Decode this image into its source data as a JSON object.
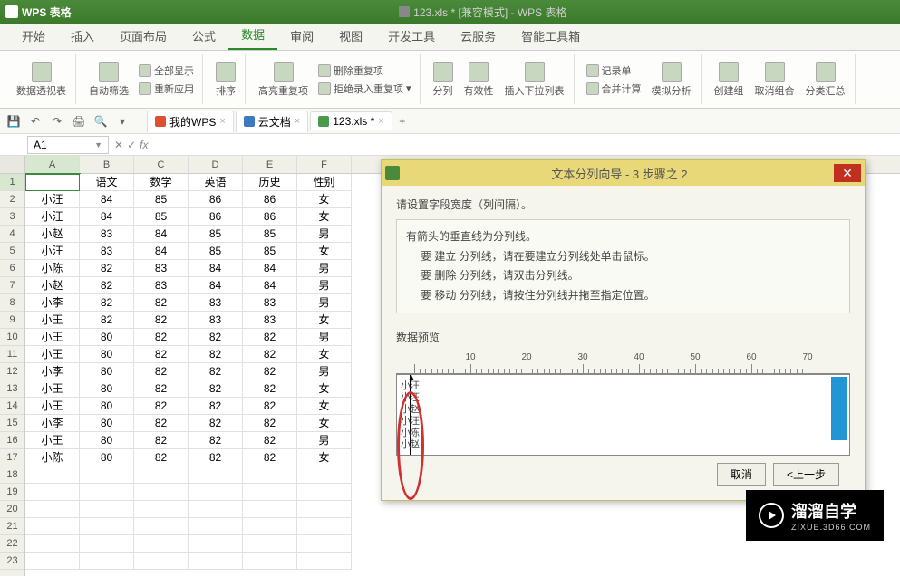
{
  "app": {
    "name": "WPS 表格",
    "doc": "123.xls * [兼容模式] - WPS 表格"
  },
  "menu": {
    "tabs": [
      "开始",
      "插入",
      "页面布局",
      "公式",
      "数据",
      "审阅",
      "视图",
      "开发工具",
      "云服务",
      "智能工具箱"
    ],
    "active": 4
  },
  "ribbon": {
    "pivot": "数据透视表",
    "autofilter": "自动筛选",
    "showall": "全部显示",
    "reapply": "重新应用",
    "sort": "排序",
    "highlight": "高亮重复项",
    "removedup": "删除重复项",
    "rejectdup": "拒绝录入重复项",
    "texttocols": "分列",
    "validation": "有效性",
    "insertdrop": "插入下拉列表",
    "recordsheet": "记录单",
    "consolidate": "合并计算",
    "whatif": "模拟分析",
    "group": "创建组",
    "ungroup": "取消组合",
    "subtotal": "分类汇总"
  },
  "doctabs": {
    "t1": "我的WPS",
    "t2": "云文档",
    "t3": "123.xls *"
  },
  "namebox": "A1",
  "sheet": {
    "cols": [
      "A",
      "B",
      "C",
      "D",
      "E",
      "F"
    ],
    "headers_row": [
      "",
      "语文",
      "数学",
      "英语",
      "历史",
      "性别"
    ],
    "rows": [
      [
        "小汪",
        "84",
        "85",
        "86",
        "86",
        "女"
      ],
      [
        "小汪",
        "84",
        "85",
        "86",
        "86",
        "女"
      ],
      [
        "小赵",
        "83",
        "84",
        "85",
        "85",
        "男"
      ],
      [
        "小汪",
        "83",
        "84",
        "85",
        "85",
        "女"
      ],
      [
        "小陈",
        "82",
        "83",
        "84",
        "84",
        "男"
      ],
      [
        "小赵",
        "82",
        "83",
        "84",
        "84",
        "男"
      ],
      [
        "小李",
        "82",
        "82",
        "83",
        "83",
        "男"
      ],
      [
        "小王",
        "82",
        "82",
        "83",
        "83",
        "女"
      ],
      [
        "小王",
        "80",
        "82",
        "82",
        "82",
        "男"
      ],
      [
        "小王",
        "80",
        "82",
        "82",
        "82",
        "女"
      ],
      [
        "小李",
        "80",
        "82",
        "82",
        "82",
        "男"
      ],
      [
        "小王",
        "80",
        "82",
        "82",
        "82",
        "女"
      ],
      [
        "小王",
        "80",
        "82",
        "82",
        "82",
        "女"
      ],
      [
        "小李",
        "80",
        "82",
        "82",
        "82",
        "女"
      ],
      [
        "小王",
        "80",
        "82",
        "82",
        "82",
        "男"
      ],
      [
        "小陈",
        "80",
        "82",
        "82",
        "82",
        "女"
      ]
    ]
  },
  "dialog": {
    "title": "文本分列向导 - 3 步骤之 2",
    "line1": "请设置字段宽度（列间隔）。",
    "line2": "有箭头的垂直线为分列线。",
    "li1": "要 建立 分列线，请在要建立分列线处单击鼠标。",
    "li2": "要 删除 分列线，请双击分列线。",
    "li3": "要 移动 分列线，请按住分列线并拖至指定位置。",
    "previewlabel": "数据预览",
    "ticks": [
      "10",
      "20",
      "30",
      "40",
      "50",
      "60",
      "70"
    ],
    "previewtext": "小汪\n小汪\n小赵\n小汪\n小陈\n小赵",
    "btn_cancel": "取消",
    "btn_back": "<上一步"
  },
  "watermark": {
    "big": "溜溜自学",
    "small": "ZIXUE.3D66.COM"
  }
}
